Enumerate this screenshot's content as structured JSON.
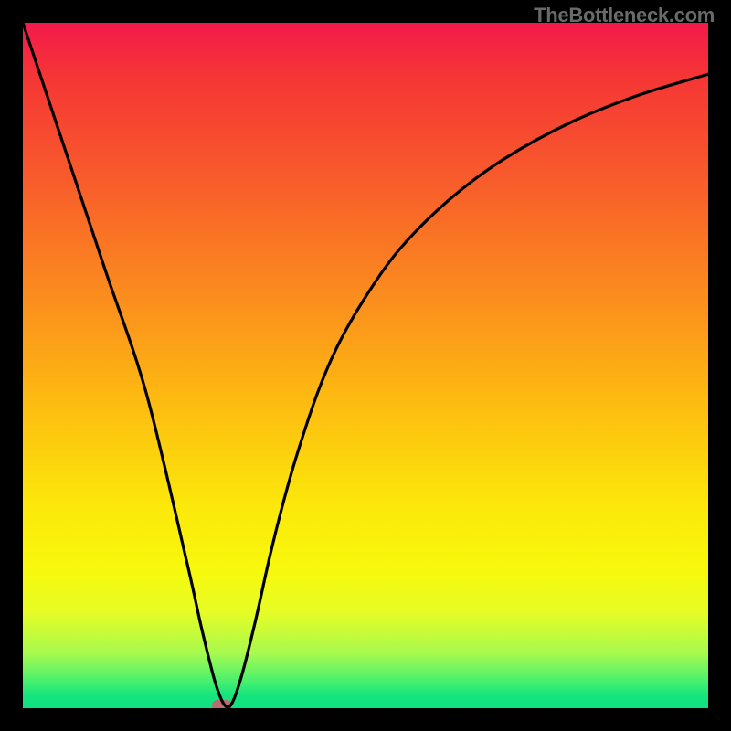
{
  "watermark": "TheBottleneck.com",
  "chart_data": {
    "type": "line",
    "title": "",
    "xlabel": "",
    "ylabel": "",
    "xlim": [
      0,
      100
    ],
    "ylim": [
      0,
      100
    ],
    "x": [
      0,
      3,
      6,
      12,
      18,
      24,
      26,
      28,
      29.4,
      30.5,
      32,
      34,
      36,
      38,
      40,
      43,
      46,
      50,
      55,
      62,
      70,
      80,
      90,
      100
    ],
    "values": [
      100,
      91,
      82,
      64,
      46,
      21,
      12,
      4,
      0.5,
      0.7,
      5,
      13,
      22,
      30,
      37,
      46,
      53,
      60,
      67,
      74,
      80,
      85.5,
      89.5,
      92.5
    ],
    "marker": {
      "x": 29,
      "y": 0.4,
      "color": "#bb6d6e"
    },
    "background_gradient": {
      "orientation": "vertical",
      "stops": [
        {
          "pos": 0.0,
          "color": "#f21a4b"
        },
        {
          "pos": 0.08,
          "color": "#f53635"
        },
        {
          "pos": 0.23,
          "color": "#f85c2b"
        },
        {
          "pos": 0.4,
          "color": "#fb8d1e"
        },
        {
          "pos": 0.55,
          "color": "#fdba11"
        },
        {
          "pos": 0.7,
          "color": "#fce70a"
        },
        {
          "pos": 0.8,
          "color": "#f7f90d"
        },
        {
          "pos": 0.86,
          "color": "#e6fc25"
        },
        {
          "pos": 0.92,
          "color": "#a7fa4e"
        },
        {
          "pos": 0.96,
          "color": "#4af06e"
        },
        {
          "pos": 0.98,
          "color": "#18e57c"
        },
        {
          "pos": 1.0,
          "color": "#0ee081"
        }
      ]
    }
  },
  "colors": {
    "frame": "#000000",
    "curve": "#000000",
    "marker": "#bb6d6e",
    "watermark": "#6a6a6a"
  }
}
